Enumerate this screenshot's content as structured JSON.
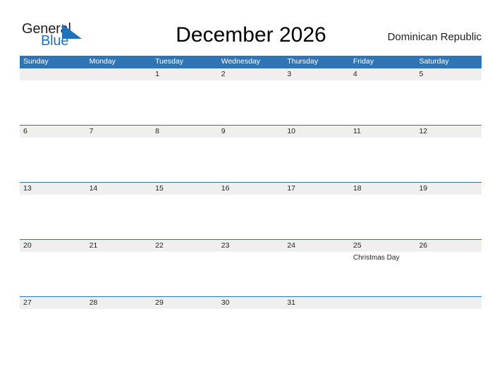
{
  "brand": {
    "name_part1": "General",
    "name_part2": "Blue",
    "triangle_color": "#1f72bd",
    "text_color_part1": "#231f20"
  },
  "header": {
    "title": "December 2026",
    "country": "Dominican Republic"
  },
  "colors": {
    "header_blue": "#2f75b5",
    "date_band_gray": "#efefef",
    "text_dark": "#231f20",
    "page_background": "#ffffff"
  },
  "calendar": {
    "month": "December",
    "year": "2026",
    "weekday_headers": [
      "Sunday",
      "Monday",
      "Tuesday",
      "Wednesday",
      "Thursday",
      "Friday",
      "Saturday"
    ],
    "weeks": [
      [
        {
          "day": "",
          "events": []
        },
        {
          "day": "",
          "events": []
        },
        {
          "day": "1",
          "events": []
        },
        {
          "day": "2",
          "events": []
        },
        {
          "day": "3",
          "events": []
        },
        {
          "day": "4",
          "events": []
        },
        {
          "day": "5",
          "events": []
        }
      ],
      [
        {
          "day": "6",
          "events": []
        },
        {
          "day": "7",
          "events": []
        },
        {
          "day": "8",
          "events": []
        },
        {
          "day": "9",
          "events": []
        },
        {
          "day": "10",
          "events": []
        },
        {
          "day": "11",
          "events": []
        },
        {
          "day": "12",
          "events": []
        }
      ],
      [
        {
          "day": "13",
          "events": []
        },
        {
          "day": "14",
          "events": []
        },
        {
          "day": "15",
          "events": []
        },
        {
          "day": "16",
          "events": []
        },
        {
          "day": "17",
          "events": []
        },
        {
          "day": "18",
          "events": []
        },
        {
          "day": "19",
          "events": []
        }
      ],
      [
        {
          "day": "20",
          "events": []
        },
        {
          "day": "21",
          "events": []
        },
        {
          "day": "22",
          "events": []
        },
        {
          "day": "23",
          "events": []
        },
        {
          "day": "24",
          "events": []
        },
        {
          "day": "25",
          "events": [
            "Christmas Day"
          ]
        },
        {
          "day": "26",
          "events": []
        }
      ],
      [
        {
          "day": "27",
          "events": []
        },
        {
          "day": "28",
          "events": []
        },
        {
          "day": "29",
          "events": []
        },
        {
          "day": "30",
          "events": []
        },
        {
          "day": "31",
          "events": []
        },
        {
          "day": "",
          "events": []
        },
        {
          "day": "",
          "events": []
        }
      ]
    ]
  }
}
